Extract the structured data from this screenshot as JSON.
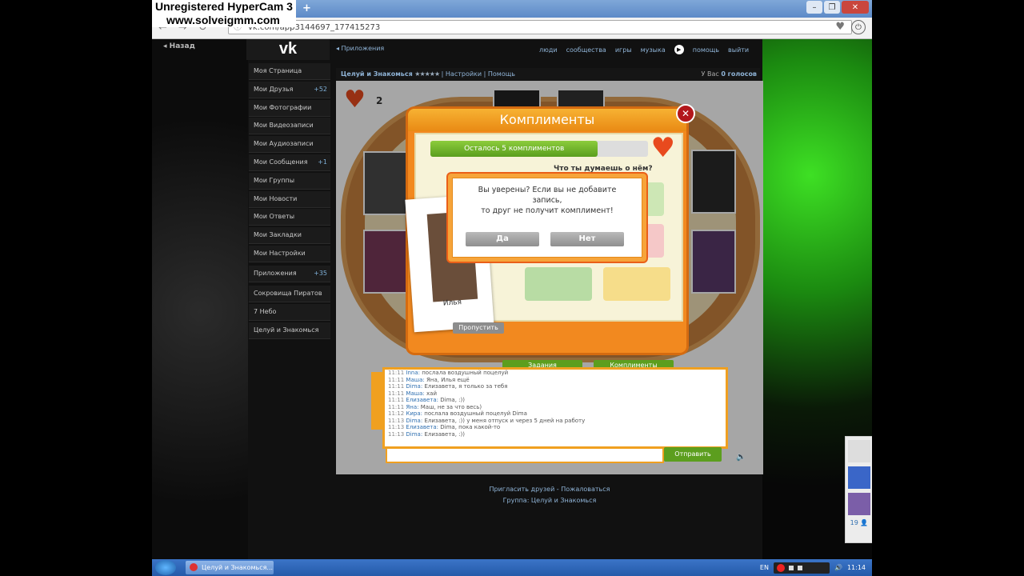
{
  "watermark": {
    "line1": "Unregistered HyperCam 3",
    "line2": "www.solveigmm.com"
  },
  "browser": {
    "url": "vk.com/app3144697_177415273",
    "new_tab": "+"
  },
  "vk": {
    "back": "Назад",
    "logo": "vk",
    "apps_link": "◂ Приложения",
    "nav": [
      "люди",
      "сообщества",
      "игры",
      "музыка",
      "помощь",
      "выйти"
    ],
    "sidebar": [
      {
        "label": "Моя Страница",
        "count": ""
      },
      {
        "label": "Мои Друзья",
        "count": "+52"
      },
      {
        "label": "Мои Фотографии",
        "count": ""
      },
      {
        "label": "Мои Видеозаписи",
        "count": ""
      },
      {
        "label": "Мои Аудиозаписи",
        "count": ""
      },
      {
        "label": "Мои Сообщения",
        "count": "+1"
      },
      {
        "label": "Мои Группы",
        "count": ""
      },
      {
        "label": "Мои Новости",
        "count": ""
      },
      {
        "label": "Мои Ответы",
        "count": ""
      },
      {
        "label": "Мои Закладки",
        "count": ""
      },
      {
        "label": "Мои Настройки",
        "count": ""
      },
      {
        "label": "Приложения",
        "count": "+35"
      },
      {
        "label": "Сокровища Пиратов",
        "count": ""
      },
      {
        "label": "7 Небо",
        "count": ""
      },
      {
        "label": "Целуй и Знакомься",
        "count": ""
      }
    ],
    "app_header": {
      "title": "Целуй и Знакомься",
      "stars": "★★★★★",
      "settings": "Настройки",
      "help": "Помощь",
      "votes_prefix": "У Вас",
      "votes_count": "0 голосов"
    },
    "footer": {
      "line1": "Пригласить друзей - Пожаловаться",
      "line2": "Группа: Целуй и Знакомься"
    },
    "online_count": "19"
  },
  "game": {
    "hearts": "2",
    "dialog_title": "Комплименты",
    "progress_text": "Осталось 5 комплиментов",
    "progress_fraction": 0.77,
    "question": "Что ты думаешь о нём?",
    "friend_name": "Илья",
    "skip_label": "Пропустить",
    "tasks_label": "Задания",
    "compliments_label": "Комплименты",
    "close": "✕",
    "confirm": {
      "line1": "Вы уверены? Если вы не добавите",
      "line2": "запись,",
      "line3": "то друг не получит комплимент!",
      "yes": "Да",
      "no": "Нет"
    },
    "chat": [
      {
        "time": "11:11",
        "name": "Inna",
        "text": "послала воздушный поцелуй"
      },
      {
        "time": "11:11",
        "name": "Маша",
        "text": "Яна, Илья ещё"
      },
      {
        "time": "11:11",
        "name": "Dima",
        "text": "Елизавета, я только за тебя"
      },
      {
        "time": "11:11",
        "name": "Маша",
        "text": "хай"
      },
      {
        "time": "11:11",
        "name": "Елизавета",
        "text": "Dima, :))"
      },
      {
        "time": "11:11",
        "name": "Яна",
        "text": "Маш, не за что весь)"
      },
      {
        "time": "11:12",
        "name": "Кира",
        "text": "послала воздушный поцелуй Dima"
      },
      {
        "time": "11:13",
        "name": "Dima",
        "text": "Елизавета, :)) у меня отпуск и через 5 дней на работу"
      },
      {
        "time": "11:13",
        "name": "Елизавета",
        "text": "Dima, пока какой-то"
      },
      {
        "time": "11:13",
        "name": "Dima",
        "text": "Елизавета, :))"
      }
    ],
    "send_label": "Отправить"
  },
  "taskbar": {
    "item": "Целуй и Знакомься...",
    "lang": "EN",
    "time": "11:14"
  },
  "colors": {
    "accent": "#8fb3d6",
    "orange": "#f2891f",
    "green": "#5c9e1e"
  }
}
